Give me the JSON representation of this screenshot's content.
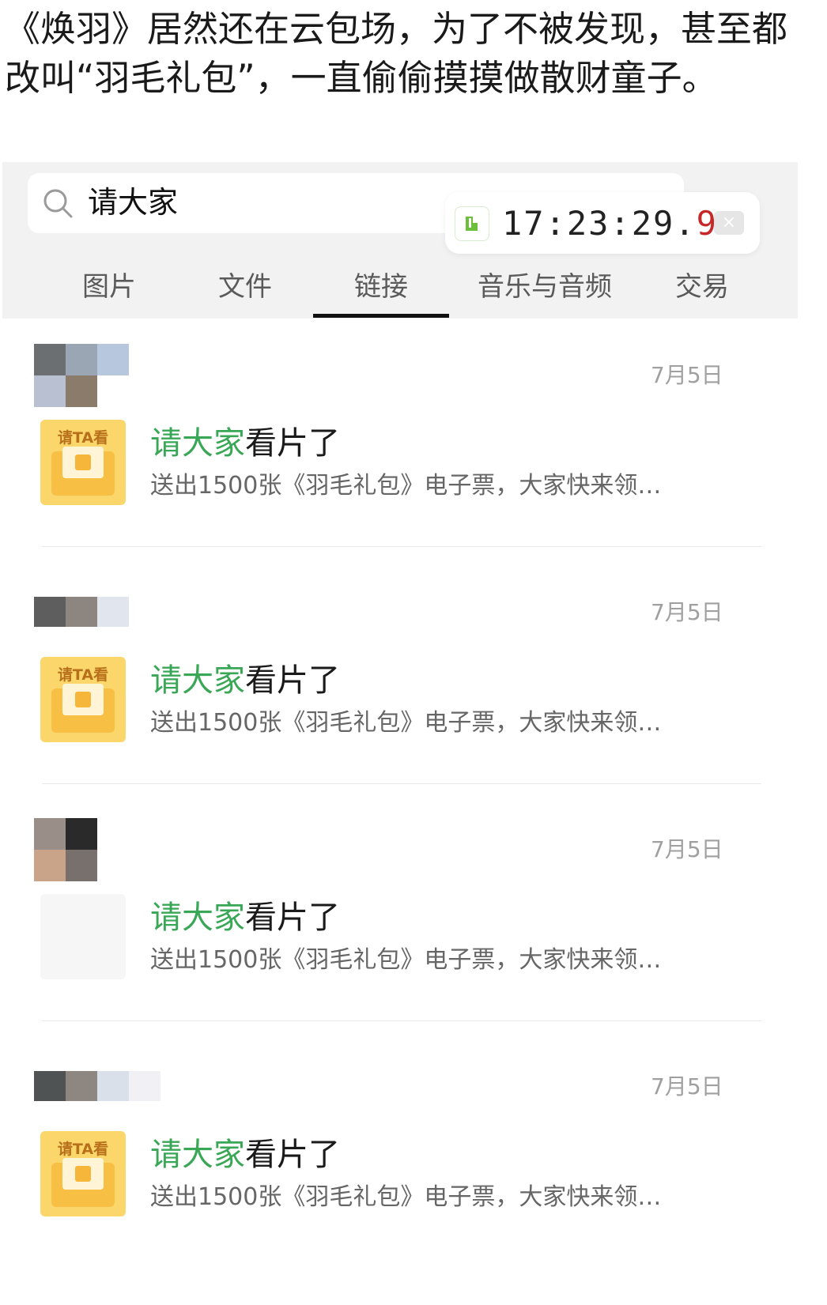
{
  "caption": "《焕羽》居然还在云包场，为了不被发现，甚至都改叫“羽毛礼包”，一直偷偷摸摸做散财童子。",
  "search": {
    "query": "请大家"
  },
  "timer": {
    "time_main": "17:23:29.",
    "time_tenth": "9",
    "close_symbol": "×"
  },
  "tabs": [
    {
      "label": "图片"
    },
    {
      "label": "文件"
    },
    {
      "label": "链接",
      "active": true
    },
    {
      "label": "音乐与音频"
    },
    {
      "label": "交易"
    }
  ],
  "results": [
    {
      "date": "7月5日",
      "thumb_label": "请TA看",
      "title_highlight": "请大家",
      "title_rest": "看片了",
      "desc": "送出1500张《羽毛礼包》电子票，大家快来领…"
    },
    {
      "date": "7月5日",
      "thumb_label": "请TA看",
      "title_highlight": "请大家",
      "title_rest": "看片了",
      "desc": "送出1500张《羽毛礼包》电子票，大家快来领…"
    },
    {
      "date": "7月5日",
      "thumb_label": "",
      "title_highlight": "请大家",
      "title_rest": "看片了",
      "desc": "送出1500张《羽毛礼包》电子票，大家快来领…"
    },
    {
      "date": "7月5日",
      "thumb_label": "请TA看",
      "title_highlight": "请大家",
      "title_rest": "看片了",
      "desc": "送出1500张《羽毛礼包》电子票，大家快来领…"
    }
  ],
  "colors": {
    "highlight": "#3aa757",
    "tab_active_underline": "#111111",
    "timer_tenth": "#c62828"
  }
}
